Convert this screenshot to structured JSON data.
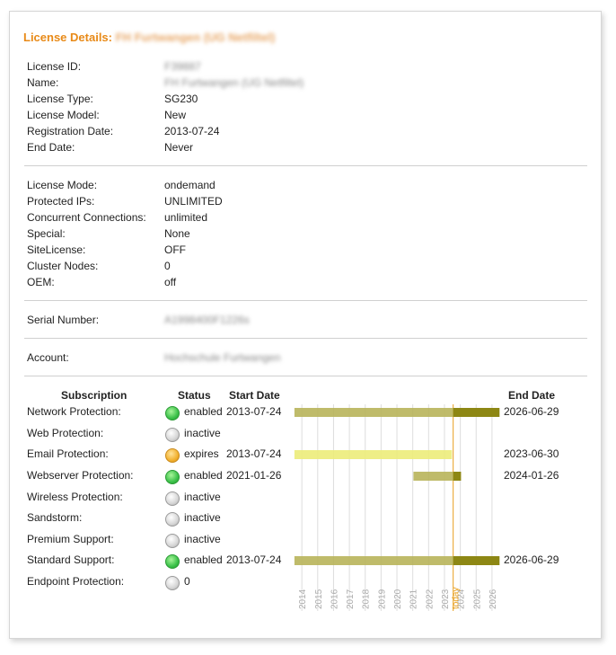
{
  "title": {
    "label": "License Details:",
    "name": "FH Furtwangen (UG Netfiltel)"
  },
  "details": [
    {
      "label": "License ID:",
      "value": "F39887",
      "blurred": true
    },
    {
      "label": "Name:",
      "value": "FH Furtwangen (UG Netfiltel)",
      "blurred": true
    },
    {
      "label": "License Type:",
      "value": "SG230"
    },
    {
      "label": "License Model:",
      "value": "New"
    },
    {
      "label": "Registration Date:",
      "value": "2013-07-24"
    },
    {
      "label": "End Date:",
      "value": "Never"
    }
  ],
  "mode": [
    {
      "label": "License Mode:",
      "value": "ondemand"
    },
    {
      "label": "Protected IPs:",
      "value": "UNLIMITED"
    },
    {
      "label": "Concurrent Connections:",
      "value": "unlimited"
    },
    {
      "label": "Special:",
      "value": "None"
    },
    {
      "label": "SiteLicense:",
      "value": "OFF"
    },
    {
      "label": "Cluster Nodes:",
      "value": "0"
    },
    {
      "label": "OEM:",
      "value": "off"
    }
  ],
  "serial": {
    "label": "Serial Number:",
    "value": "A1998400F1226s"
  },
  "account": {
    "label": "Account:",
    "value": "Hochschule Furtwangen"
  },
  "subs_header": {
    "subscription": "Subscription",
    "status": "Status",
    "start": "Start Date",
    "end": "End Date"
  },
  "subscriptions": [
    {
      "name": "Network Protection:",
      "status": "enabled",
      "state": "green",
      "start": "2013-07-24",
      "end": "2026-06-29",
      "bar_from": 2013.56,
      "bar_to": 2026.5,
      "today_split": true,
      "color": "olive"
    },
    {
      "name": "Web Protection:",
      "status": "inactive",
      "state": "grey",
      "start": "",
      "end": ""
    },
    {
      "name": "Email Protection:",
      "status": "expires",
      "state": "orange",
      "start": "2013-07-24",
      "end": "2023-06-30",
      "bar_from": 2013.56,
      "bar_to": 2023.5,
      "today_split": false,
      "color": "yellow"
    },
    {
      "name": "Webserver Protection:",
      "status": "enabled",
      "state": "green",
      "start": "2021-01-26",
      "end": "2024-01-26",
      "bar_from": 2021.07,
      "bar_to": 2024.07,
      "today_split": true,
      "color": "olive"
    },
    {
      "name": "Wireless Protection:",
      "status": "inactive",
      "state": "grey",
      "start": "",
      "end": ""
    },
    {
      "name": "Sandstorm:",
      "status": "inactive",
      "state": "grey",
      "start": "",
      "end": ""
    },
    {
      "name": "Premium Support:",
      "status": "inactive",
      "state": "grey",
      "start": "",
      "end": ""
    },
    {
      "name": "Standard Support:",
      "status": "enabled",
      "state": "green",
      "start": "2013-07-24",
      "end": "2026-06-29",
      "bar_from": 2013.56,
      "bar_to": 2026.5,
      "today_split": true,
      "color": "olive"
    },
    {
      "name": "Endpoint Protection:",
      "status": "0",
      "state": "grey",
      "start": "",
      "end": ""
    }
  ],
  "timeline": {
    "years": [
      "2014",
      "2015",
      "2016",
      "2017",
      "2018",
      "2019",
      "2020",
      "2021",
      "2022",
      "2023",
      "2024",
      "2025",
      "2026"
    ],
    "start_year": 2013.0,
    "end_year": 2026.6,
    "today_label": "today",
    "today": 2023.55,
    "colors": {
      "olive": "#b8b45a",
      "olive_dark": "#8a8410",
      "yellow": "#ecec7a",
      "today": "#e8a020",
      "grid": "#dddddd"
    }
  }
}
